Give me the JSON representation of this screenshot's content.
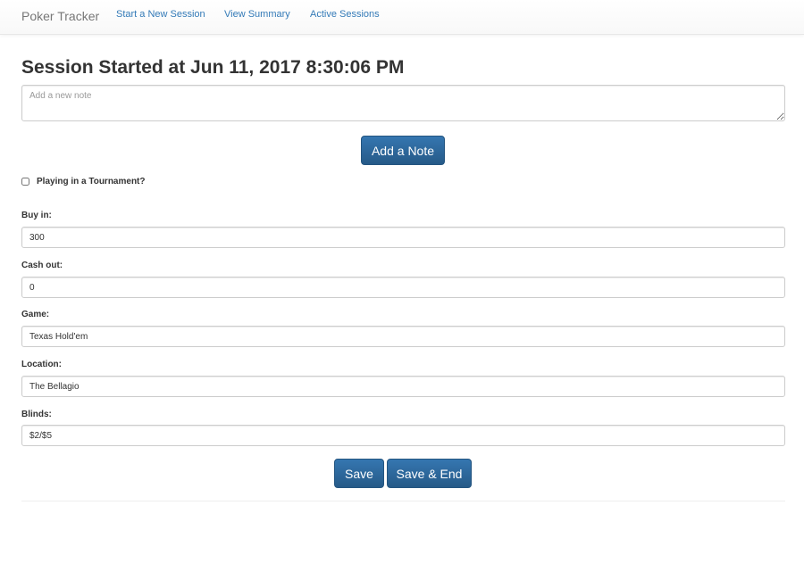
{
  "navbar": {
    "brand": "Poker Tracker",
    "links": [
      {
        "label": "Start a New Session"
      },
      {
        "label": "View Summary"
      },
      {
        "label": "Active Sessions"
      }
    ]
  },
  "session": {
    "title": "Session Started at Jun 11, 2017 8:30:06 PM",
    "note_placeholder": "Add a new note",
    "add_note_label": "Add a Note",
    "tournament_label": "Playing in a Tournament?",
    "tournament_checked": false
  },
  "fields": {
    "buy_in": {
      "label": "Buy in:",
      "value": "300"
    },
    "cash_out": {
      "label": "Cash out:",
      "value": "0"
    },
    "game": {
      "label": "Game:",
      "value": "Texas Hold'em"
    },
    "location": {
      "label": "Location:",
      "value": "The Bellagio"
    },
    "blinds": {
      "label": "Blinds:",
      "value": "$2/$5"
    }
  },
  "actions": {
    "save_label": "Save",
    "save_end_label": "Save & End"
  },
  "colors": {
    "link": "#337ab7",
    "primary_button": "#2e6da4",
    "brand_text": "#777777"
  }
}
